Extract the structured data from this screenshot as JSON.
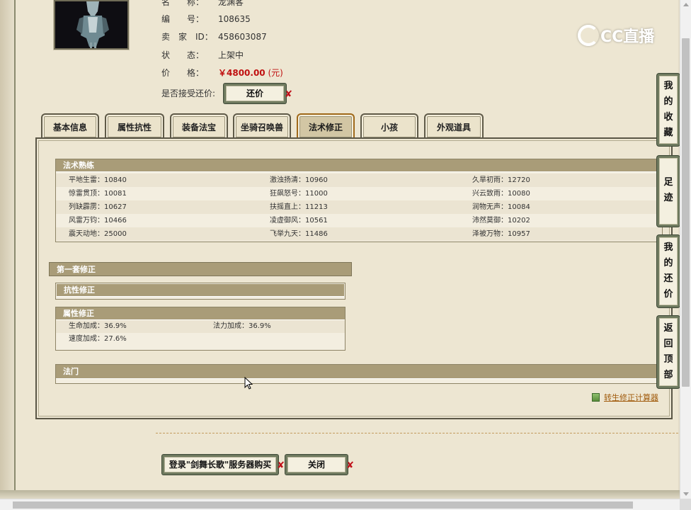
{
  "item": {
    "name_label": "名　　称：",
    "name_value": "龙渊客",
    "id_label": "编　　号：",
    "id_value": "108635",
    "seller_label": "卖　家　ID：",
    "seller_value": "458603087",
    "status_label": "状　　态：",
    "status_value": "上架中",
    "price_label": "价　　格：",
    "price_value": "￥4800.00",
    "price_unit": "(元)",
    "bargain_label": "是否接受还价:",
    "bargain_button": "还价"
  },
  "watermark": {
    "text": "CC直播",
    "icon": "cc-logo-icon"
  },
  "tabs": [
    {
      "label": "基本信息",
      "active": false
    },
    {
      "label": "属性抗性",
      "active": false
    },
    {
      "label": "装备法宝",
      "active": false
    },
    {
      "label": "坐骑召唤兽",
      "active": false
    },
    {
      "label": "法术修正",
      "active": true
    },
    {
      "label": "小孩",
      "active": false
    },
    {
      "label": "外观道具",
      "active": false
    }
  ],
  "skills": {
    "title": "法术熟练",
    "rows": [
      [
        "平地生雷：10840",
        "激浊扬清：10960",
        "久旱初雨：12720"
      ],
      [
        "惊雷贯顶：10081",
        "狂飙怒号：11000",
        "兴云致雨：10080"
      ],
      [
        "列缺霹雳：10627",
        "扶摇直上：11213",
        "润物无声：10084"
      ],
      [
        "风雷万钧：10466",
        "凌虚御风：10561",
        "沛然莫御：10202"
      ],
      [
        "震天动地：25000",
        "飞举九天：11486",
        "泽被万物：10957"
      ]
    ]
  },
  "correction": {
    "set_title": "第一套修正",
    "resist_title": "抗性修正",
    "attr_title": "属性修正",
    "attr_rows": [
      [
        "生命加成：36.9%",
        "法力加成：36.9%"
      ],
      [
        "速度加成：27.6%",
        ""
      ]
    ],
    "sect_title": "法门"
  },
  "calculator_link": "转生修正计算器",
  "buttons": {
    "login_buy": "登录\"剑舞长歌\"服务器购买",
    "close": "关闭"
  },
  "side_nav": [
    {
      "label": "我的收藏",
      "chars": [
        "我",
        "的",
        "收",
        "藏"
      ]
    },
    {
      "label": "足迹",
      "chars": [
        "足",
        "迹"
      ]
    },
    {
      "label": "我的还价",
      "chars": [
        "我",
        "的",
        "还",
        "价"
      ]
    },
    {
      "label": "返回顶部",
      "chars": [
        "返",
        "回",
        "顶",
        "部"
      ]
    }
  ],
  "colors": {
    "accent_red": "#c01010",
    "header_tan": "#a99c78",
    "link_orange": "#a05a0b"
  }
}
